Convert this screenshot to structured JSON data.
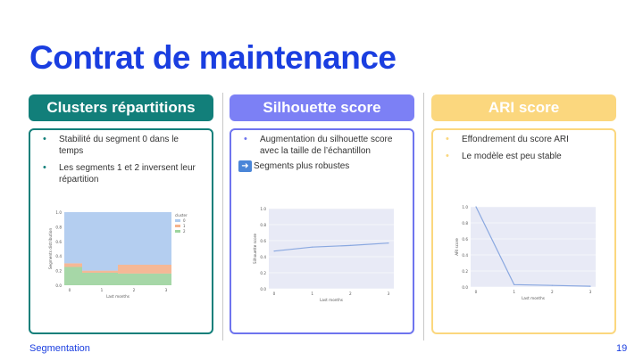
{
  "slide": {
    "title": "Contrat de maintenance",
    "footer_left": "Segmentation",
    "page_number": "19"
  },
  "columns": [
    {
      "header": "Clusters répartitions",
      "bullets": [
        "Stabilité du segment 0 dans le temps",
        "Les segments 1 et 2 inversent leur répartition"
      ]
    },
    {
      "header": "Silhouette score",
      "bullets": [
        "Augmentation du silhouette score avec la taille de l’échantillon"
      ],
      "note": "Segments plus robustes",
      "note_icon": "right-arrow-emoji-icon"
    },
    {
      "header": "ARI score",
      "bullets": [
        "Effondrement du score ARI",
        "Le modèle est peu stable"
      ]
    }
  ],
  "colors": {
    "title": "#1a3ee0",
    "teal": "#127f7a",
    "violet": "#7c80f5",
    "yellow": "#fbd77e",
    "plot_bg": "#e8eaf6",
    "series_0": "#aecbef",
    "series_1": "#f6b38c",
    "series_2": "#9ed59e",
    "line": "#8aa8e0"
  },
  "chart_data": [
    {
      "type": "area",
      "xlabel": "Last months",
      "ylabel": "Segments distribution",
      "x": [
        0,
        1,
        2,
        3
      ],
      "xticks": [
        "0",
        "1",
        "2",
        "3"
      ],
      "ylim": [
        0,
        1.0
      ],
      "yticks": [
        "0.0",
        "0.2",
        "0.4",
        "0.6",
        "0.8",
        "1.0"
      ],
      "legend_title": "cluster",
      "legend_placement": "right",
      "series": [
        {
          "name": "0",
          "values": [
            0.7,
            0.8,
            0.72,
            0.72
          ]
        },
        {
          "name": "1",
          "values": [
            0.05,
            0.03,
            0.12,
            0.12
          ]
        },
        {
          "name": "2",
          "values": [
            0.25,
            0.17,
            0.16,
            0.16
          ]
        }
      ]
    },
    {
      "type": "line",
      "xlabel": "Last months",
      "ylabel": "Silhouette score",
      "x": [
        0,
        1,
        2,
        3
      ],
      "xticks": [
        "0",
        "1",
        "2",
        "3"
      ],
      "ylim": [
        0,
        1.0
      ],
      "yticks": [
        "0.0",
        "0.2",
        "0.4",
        "0.6",
        "0.8",
        "1.0"
      ],
      "series": [
        {
          "values": [
            0.47,
            0.52,
            0.54,
            0.57
          ]
        }
      ]
    },
    {
      "type": "line",
      "xlabel": "Last months",
      "ylabel": "ARI score",
      "x": [
        0,
        1,
        2,
        3
      ],
      "xticks": [
        "0",
        "1",
        "2",
        "3"
      ],
      "ylim": [
        0,
        1.0
      ],
      "yticks": [
        "0.0",
        "0.2",
        "0.4",
        "0.6",
        "0.8",
        "1.0"
      ],
      "series": [
        {
          "values": [
            1.0,
            0.03,
            0.02,
            0.01
          ]
        }
      ]
    }
  ]
}
